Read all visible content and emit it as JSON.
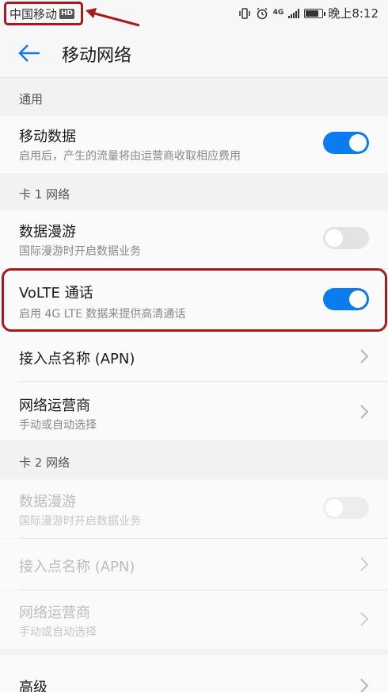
{
  "status_bar": {
    "carrier": "中国移动",
    "hd_badge": "HD",
    "network_type": "4G",
    "time": "晚上8:12"
  },
  "header": {
    "title": "移动网络",
    "back_icon": "arrow-left-icon"
  },
  "sections": {
    "general": {
      "header": "通用"
    },
    "sim1": {
      "header": "卡 1 网络"
    },
    "sim2": {
      "header": "卡 2 网络"
    }
  },
  "rows": {
    "mobile_data": {
      "title": "移动数据",
      "subtitle": "启用后，产生的流量将由运营商收取相应费用",
      "on": true
    },
    "sim1_roaming": {
      "title": "数据漫游",
      "subtitle": "国际漫游时开启数据业务",
      "on": false
    },
    "volte": {
      "title": "VoLTE 通话",
      "subtitle": "启用 4G LTE 数据来提供高清通话",
      "on": true
    },
    "sim1_apn": {
      "title": "接入点名称 (APN)"
    },
    "sim1_operator": {
      "title": "网络运营商",
      "subtitle": "手动或自动选择"
    },
    "sim2_roaming": {
      "title": "数据漫游",
      "subtitle": "国际漫游时开启数据业务",
      "on": false
    },
    "sim2_apn": {
      "title": "接入点名称 (APN)"
    },
    "sim2_operator": {
      "title": "网络运营商",
      "subtitle": "手动或自动选择"
    },
    "advanced": {
      "title": "高级"
    }
  },
  "colors": {
    "accent": "#0a7cf0",
    "annotation": "#a8191e"
  }
}
